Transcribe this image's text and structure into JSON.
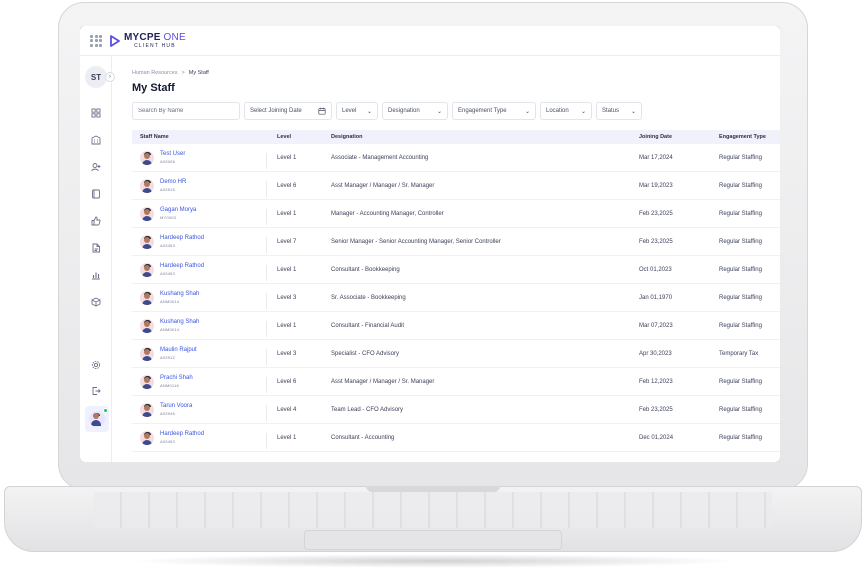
{
  "brand": {
    "name_main": "MYCPE",
    "name_accent": "ONE",
    "subtitle": "CLIENT HUB",
    "accent": "#5a4fe0",
    "primary": "#1e2256"
  },
  "sidebar": {
    "user_initials": "ST",
    "icons": [
      "dashboard-icon",
      "building-icon",
      "add-user-icon",
      "book-icon",
      "thumbs-up-icon",
      "document-icon",
      "bar-chart-icon",
      "cube-icon",
      "settings-icon",
      "logout-icon"
    ]
  },
  "breadcrumb": {
    "parent": "Human Resources",
    "separator": ">",
    "current": "My Staff"
  },
  "page": {
    "title": "My Staff"
  },
  "filters": {
    "search_placeholder": "Search By Name",
    "joining_date": "Select Joining Date",
    "level": "Level",
    "designation": "Designation",
    "engagement_type": "Engagement Type",
    "location": "Location",
    "status": "Status"
  },
  "table": {
    "columns": [
      "Staff Name",
      "Level",
      "Designation",
      "Joining Date",
      "Engagement Type"
    ],
    "rows": [
      {
        "name": "Test User",
        "id": "A03006",
        "level": "Level 1",
        "designation": "Associate - Management Accounting",
        "date": "Mar 17,2024",
        "engagement": "Regular Staffing"
      },
      {
        "name": "Demo HR",
        "id": "A03515",
        "level": "Level 6",
        "designation": "Asst Manager / Manager / Sr. Manager",
        "date": "Mar 19,2023",
        "engagement": "Regular Staffing"
      },
      {
        "name": "Gagan Morya",
        "id": "MY0003",
        "level": "Level 1",
        "designation": "Manager - Accounting Manager, Controller",
        "date": "Feb 23,2025",
        "engagement": "Regular Staffing"
      },
      {
        "name": "Hardeep Rathod",
        "id": "A03453",
        "level": "Level 7",
        "designation": "Senior Manager - Senior Accounting Manager, Senior Controller",
        "date": "Feb 23,2025",
        "engagement": "Regular Staffing"
      },
      {
        "name": "Hardeep Rathod",
        "id": "A03453",
        "level": "Level 1",
        "designation": "Consultant - Bookkeeping",
        "date": "Oct 01,2023",
        "engagement": "Regular Staffing"
      },
      {
        "name": "Kushang Shah",
        "id": "ANM0014",
        "level": "Level 3",
        "designation": "Sr. Associate - Bookkeeping",
        "date": "Jan 01,1970",
        "engagement": "Regular Staffing"
      },
      {
        "name": "Kushang Shah",
        "id": "ANM0014",
        "level": "Level 1",
        "designation": "Consultant - Financial Audit",
        "date": "Mar 07,2023",
        "engagement": "Regular Staffing"
      },
      {
        "name": "Maulin Rajput",
        "id": "A03912",
        "level": "Level 3",
        "designation": "Specialist - CFO Advisory",
        "date": "Apr 30,2023",
        "engagement": "Temporary Tax"
      },
      {
        "name": "Prachi Shah",
        "id": "ANM0116",
        "level": "Level 6",
        "designation": "Asst Manager / Manager / Sr. Manager",
        "date": "Feb 12,2023",
        "engagement": "Regular Staffing"
      },
      {
        "name": "Tarun Voora",
        "id": "A03946",
        "level": "Level 4",
        "designation": "Team Lead - CFO Advisory",
        "date": "Feb 23,2025",
        "engagement": "Regular Staffing"
      },
      {
        "name": "Hardeep Rathod",
        "id": "A03453",
        "level": "Level 1",
        "designation": "Consultant - Accounting",
        "date": "Dec 01,2024",
        "engagement": "Regular Staffing"
      }
    ]
  }
}
